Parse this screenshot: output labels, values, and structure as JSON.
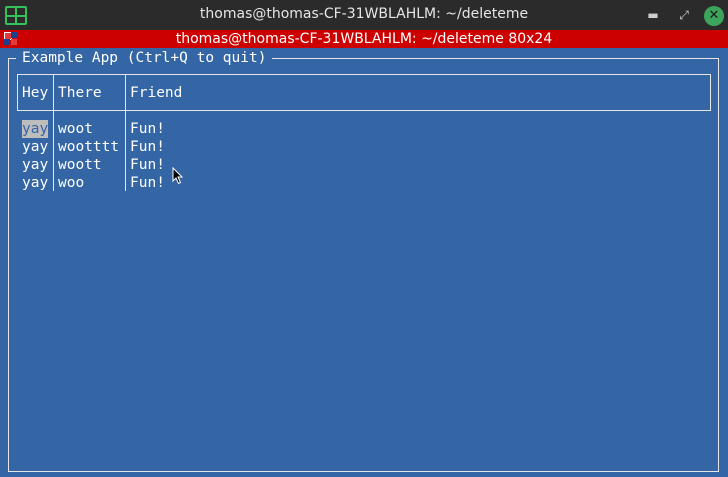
{
  "outer_window": {
    "title": "thomas@thomas-CF-31WBLAHLM: ~/deleteme",
    "minimize_glyph": "▬",
    "maximize_glyph": "⤢",
    "close_glyph": "✕",
    "app_icon": "terminal-grid-icon"
  },
  "terminal": {
    "title": "thomas@thomas-CF-31WBLAHLM: ~/deleteme 80x24",
    "background": "#3465a4",
    "title_bar_color": "#cc0000"
  },
  "app": {
    "title": "Example App (Ctrl+Q to quit)",
    "table": {
      "headers": [
        "Hey",
        "There",
        "Friend"
      ],
      "rows": [
        [
          "yay",
          "woot",
          "Fun!"
        ],
        [
          "yay",
          "wootttt",
          "Fun!"
        ],
        [
          "yay",
          "woott",
          "Fun!"
        ],
        [
          "yay",
          "woo",
          "Fun!"
        ]
      ]
    }
  }
}
